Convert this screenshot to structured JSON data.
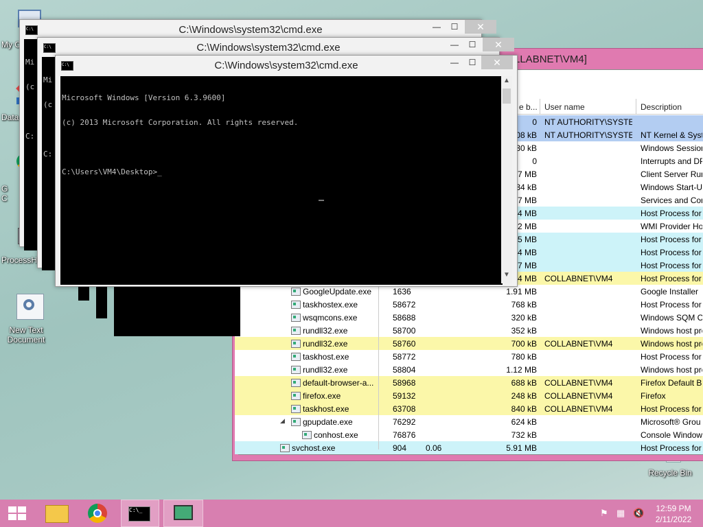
{
  "desktop": {
    "icons": [
      {
        "label": "My C",
        "name": "my-computer"
      },
      {
        "label": "Data",
        "name": "data"
      },
      {
        "label": "G\nC",
        "name": "google-chrome"
      },
      {
        "label": "ProcessH",
        "name": "process-hacker"
      },
      {
        "label": "New Text\nDocument",
        "name": "new-text-document"
      },
      {
        "label": "Recycle Bin",
        "name": "recycle-bin"
      }
    ]
  },
  "cmd_windows": [
    {
      "title": "C:\\Windows\\system32\\cmd.exe",
      "lines": [
        "Mi",
        "(c",
        "",
        "C:"
      ]
    },
    {
      "title": "C:\\Windows\\system32\\cmd.exe",
      "lines": [
        "Mi",
        "(c",
        "",
        "C:"
      ]
    },
    {
      "title": "C:\\Windows\\system32\\cmd.exe",
      "lines": [
        "Microsoft Windows [Version 6.3.9600]",
        "(c) 2013 Microsoft Corporation. All rights reserved.",
        "",
        "C:\\Users\\VM4\\Desktop>_"
      ]
    }
  ],
  "task_manager": {
    "title": "LLABNET\\VM4]",
    "headers": {
      "private_bytes": "e b...",
      "user_name": "User name",
      "description": "Description"
    },
    "rows": [
      {
        "name": "",
        "pid": "",
        "cpu": "",
        "mem": "0",
        "user": "NT AUTHORITY\\SYSTEM",
        "desc": "",
        "color": "#b3cdf2",
        "indent": 0
      },
      {
        "name": "",
        "pid": "",
        "cpu": "",
        "mem": "08 kB",
        "user": "NT AUTHORITY\\SYSTEM",
        "desc": "NT Kernel & System",
        "color": "#b3cdf2",
        "indent": 0
      },
      {
        "name": "",
        "pid": "",
        "cpu": "",
        "mem": "30 kB",
        "user": "",
        "desc": "Windows Session",
        "color": "#ffffff",
        "indent": 0
      },
      {
        "name": "",
        "pid": "",
        "cpu": "",
        "mem": "0",
        "user": "",
        "desc": "Interrupts and DP",
        "color": "#ffffff",
        "indent": 0
      },
      {
        "name": "",
        "pid": "",
        "cpu": "",
        "mem": "7 MB",
        "user": "",
        "desc": "Client Server Run",
        "color": "#ffffff",
        "indent": 0
      },
      {
        "name": "",
        "pid": "",
        "cpu": "",
        "mem": "34 kB",
        "user": "",
        "desc": "Windows Start-Up",
        "color": "#ffffff",
        "indent": 0
      },
      {
        "name": "",
        "pid": "",
        "cpu": "",
        "mem": "7 MB",
        "user": "",
        "desc": "Services and Con",
        "color": "#ffffff",
        "indent": 0
      },
      {
        "name": "",
        "pid": "",
        "cpu": "",
        "mem": "4 MB",
        "user": "",
        "desc": "Host Process for W",
        "color": "#cdf3f9",
        "indent": 0
      },
      {
        "name": "",
        "pid": "",
        "cpu": "",
        "mem": "2 MB",
        "user": "",
        "desc": "WMI Provider Ho",
        "color": "#ffffff",
        "indent": 0
      },
      {
        "name": "",
        "pid": "",
        "cpu": "",
        "mem": "5 MB",
        "user": "",
        "desc": "Host Process for W",
        "color": "#cdf3f9",
        "indent": 0
      },
      {
        "name": "",
        "pid": "",
        "cpu": "",
        "mem": "4 MB",
        "user": "",
        "desc": "Host Process for W",
        "color": "#cdf3f9",
        "indent": 0
      },
      {
        "name": "",
        "pid": "",
        "cpu": "",
        "mem": "7 MB",
        "user": "",
        "desc": "Host Process for W",
        "color": "#cdf3f9",
        "indent": 0
      },
      {
        "name": "",
        "pid": "",
        "cpu": "",
        "mem": "4 MB",
        "user": "COLLABNET\\VM4",
        "desc": "Host Process for W",
        "color": "#fbf7a9",
        "indent": 0
      },
      {
        "name": "GoogleUpdate.exe",
        "pid": "1636",
        "cpu": "",
        "mem": "1.91 MB",
        "user": "",
        "desc": "Google Installer",
        "color": "#ffffff",
        "indent": 2
      },
      {
        "name": "taskhostex.exe",
        "pid": "58672",
        "cpu": "",
        "mem": "768 kB",
        "user": "",
        "desc": "Host Process for W",
        "color": "#ffffff",
        "indent": 2
      },
      {
        "name": "wsqmcons.exe",
        "pid": "58688",
        "cpu": "",
        "mem": "320 kB",
        "user": "",
        "desc": "Windows SQM Co",
        "color": "#ffffff",
        "indent": 2
      },
      {
        "name": "rundll32.exe",
        "pid": "58700",
        "cpu": "",
        "mem": "352 kB",
        "user": "",
        "desc": "Windows host pro",
        "color": "#ffffff",
        "indent": 2
      },
      {
        "name": "rundll32.exe",
        "pid": "58760",
        "cpu": "",
        "mem": "700 kB",
        "user": "COLLABNET\\VM4",
        "desc": "Windows host pro",
        "color": "#fbf7a9",
        "indent": 2
      },
      {
        "name": "taskhost.exe",
        "pid": "58772",
        "cpu": "",
        "mem": "780 kB",
        "user": "",
        "desc": "Host Process for W",
        "color": "#ffffff",
        "indent": 2
      },
      {
        "name": "rundll32.exe",
        "pid": "58804",
        "cpu": "",
        "mem": "1.12 MB",
        "user": "",
        "desc": "Windows host pro",
        "color": "#ffffff",
        "indent": 2
      },
      {
        "name": "default-browser-a...",
        "pid": "58968",
        "cpu": "",
        "mem": "688 kB",
        "user": "COLLABNET\\VM4",
        "desc": "Firefox Default Br",
        "color": "#fbf7a9",
        "indent": 2
      },
      {
        "name": "firefox.exe",
        "pid": "59132",
        "cpu": "",
        "mem": "248 kB",
        "user": "COLLABNET\\VM4",
        "desc": "Firefox",
        "color": "#fbf7a9",
        "indent": 2
      },
      {
        "name": "taskhost.exe",
        "pid": "63708",
        "cpu": "",
        "mem": "840 kB",
        "user": "COLLABNET\\VM4",
        "desc": "Host Process for W",
        "color": "#fbf7a9",
        "indent": 2
      },
      {
        "name": "gpupdate.exe",
        "pid": "76292",
        "cpu": "",
        "mem": "624 kB",
        "user": "",
        "desc": "Microsoft® Grou",
        "color": "#ffffff",
        "indent": 2,
        "expander": "◢"
      },
      {
        "name": "conhost.exe",
        "pid": "76876",
        "cpu": "",
        "mem": "732 kB",
        "user": "",
        "desc": "Console Window",
        "color": "#ffffff",
        "indent": 3
      },
      {
        "name": "svchost.exe",
        "pid": "904",
        "cpu": "0.06",
        "mem": "5.91 MB",
        "user": "",
        "desc": "Host Process for W",
        "color": "#cdf3f9",
        "indent": 1
      }
    ]
  },
  "taskbar": {
    "time": "12:59 PM",
    "date": "2/11/2022",
    "accent": "#d87fb0"
  }
}
